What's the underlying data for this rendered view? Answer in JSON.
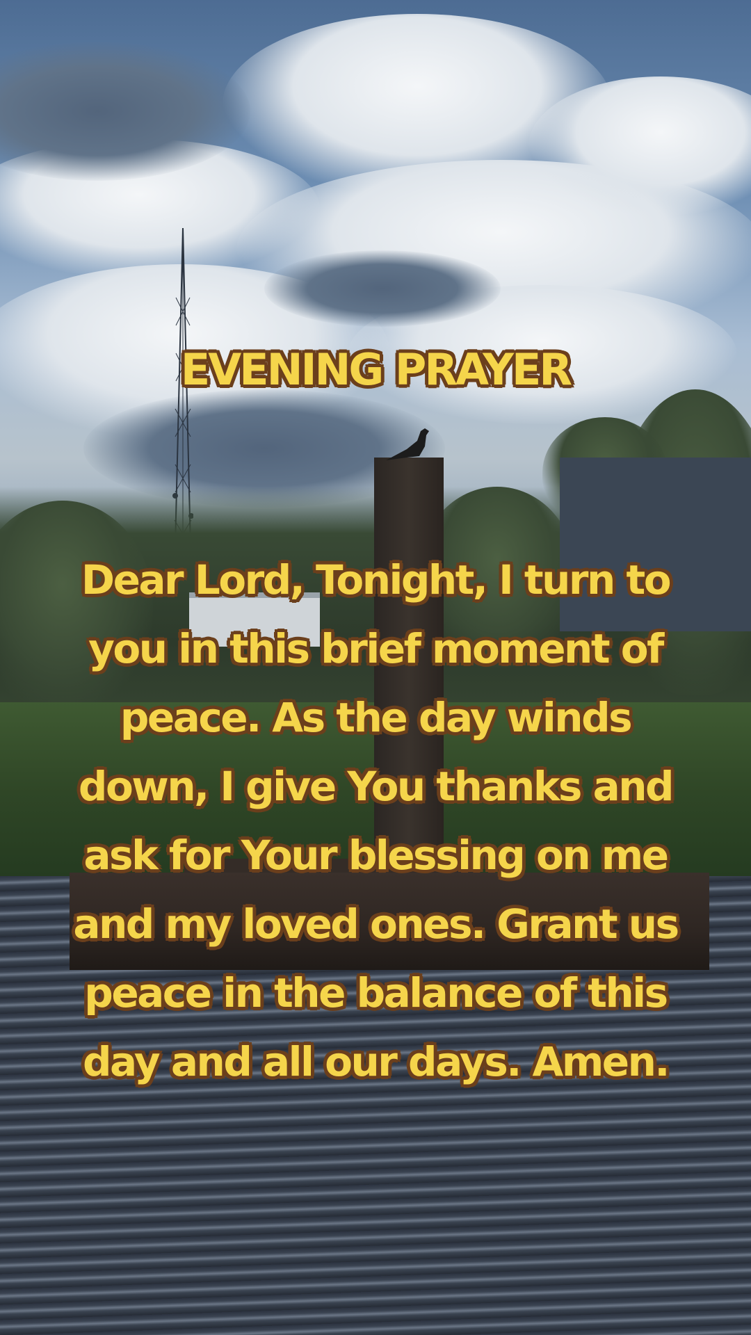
{
  "overlay": {
    "title": "EVENING PRAYER",
    "lines": [
      "Dear Lord, Tonight, I turn to",
      "you in this brief moment of",
      "peace. As the day winds",
      "down, I give You thanks and",
      "ask for Your blessing on me",
      "and my loved ones. Grant us",
      "peace in the balance of this",
      "day and all our days. Amen."
    ]
  },
  "colors": {
    "text_fill": "#f5d54b",
    "text_outline": "#6b3f1c"
  }
}
